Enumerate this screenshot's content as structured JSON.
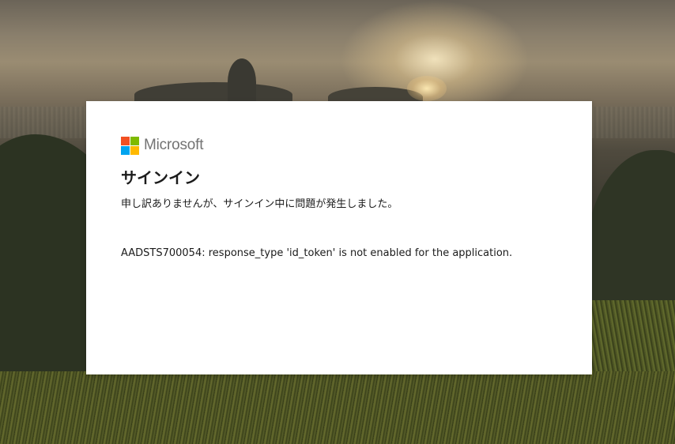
{
  "brand": {
    "name": "Microsoft",
    "logo_colors": [
      "#f25022",
      "#7fba00",
      "#00a4ef",
      "#ffb900"
    ]
  },
  "dialog": {
    "title": "サインイン",
    "message": "申し訳ありませんが、サインイン中に問題が発生しました。",
    "error_detail": "AADSTS700054: response_type 'id_token' is not enabled for the application."
  },
  "colors": {
    "card_background": "#ffffff",
    "text": "#1b1b1b",
    "brand_text": "#737373"
  }
}
